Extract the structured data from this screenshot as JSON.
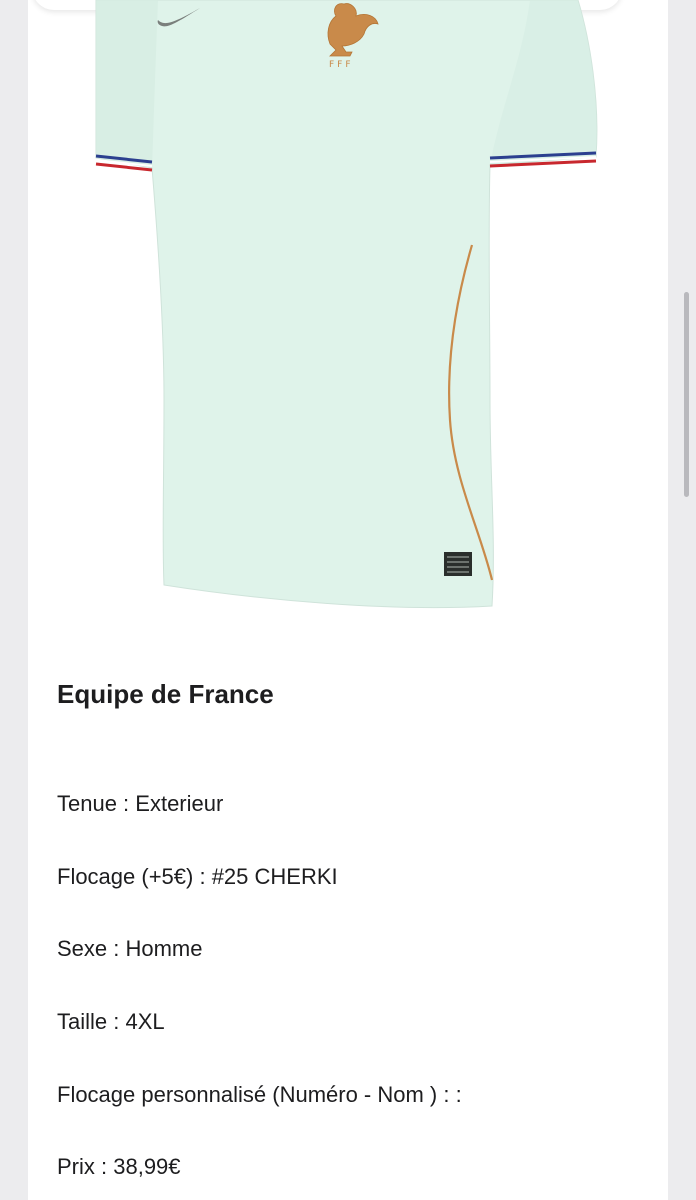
{
  "product": {
    "title": "Equipe de France",
    "image_label": "Maillot Equipe de France extérieur"
  },
  "details": [
    {
      "label": "Tenue : ",
      "value": "Exterieur"
    },
    {
      "label": "Flocage (+5€) : ",
      "value": "#25 CHERKI"
    },
    {
      "label": "Sexe : ",
      "value": "Homme"
    },
    {
      "label": "Taille : ",
      "value": "4XL"
    },
    {
      "label": "Flocage personnalisé (Numéro - Nom ) : :",
      "value": ""
    },
    {
      "label": "Prix : ",
      "value": "38,99€"
    }
  ],
  "colors": {
    "background": "#ececee",
    "card": "#ffffff",
    "jersey": "#dff3ea",
    "trim_blue": "#2b3f8f",
    "trim_red": "#c8282e",
    "piping": "#c98a4a",
    "text": "#1d1d1f"
  },
  "icons": [
    "nike-swoosh-icon",
    "fff-rooster-crest-icon",
    "jock-tag-icon"
  ]
}
